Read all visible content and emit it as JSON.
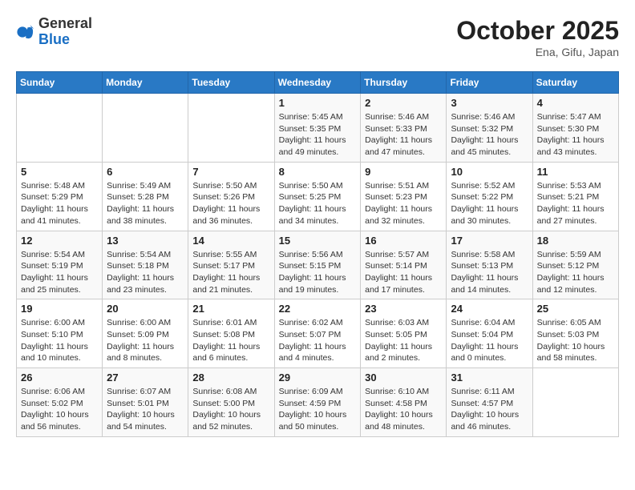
{
  "logo": {
    "general": "General",
    "blue": "Blue"
  },
  "header": {
    "month": "October 2025",
    "location": "Ena, Gifu, Japan"
  },
  "weekdays": [
    "Sunday",
    "Monday",
    "Tuesday",
    "Wednesday",
    "Thursday",
    "Friday",
    "Saturday"
  ],
  "weeks": [
    [
      {
        "day": "",
        "info": ""
      },
      {
        "day": "",
        "info": ""
      },
      {
        "day": "",
        "info": ""
      },
      {
        "day": "1",
        "sunrise": "5:45 AM",
        "sunset": "5:35 PM",
        "daylight": "11 hours and 49 minutes."
      },
      {
        "day": "2",
        "sunrise": "5:46 AM",
        "sunset": "5:33 PM",
        "daylight": "11 hours and 47 minutes."
      },
      {
        "day": "3",
        "sunrise": "5:46 AM",
        "sunset": "5:32 PM",
        "daylight": "11 hours and 45 minutes."
      },
      {
        "day": "4",
        "sunrise": "5:47 AM",
        "sunset": "5:30 PM",
        "daylight": "11 hours and 43 minutes."
      }
    ],
    [
      {
        "day": "5",
        "sunrise": "5:48 AM",
        "sunset": "5:29 PM",
        "daylight": "11 hours and 41 minutes."
      },
      {
        "day": "6",
        "sunrise": "5:49 AM",
        "sunset": "5:28 PM",
        "daylight": "11 hours and 38 minutes."
      },
      {
        "day": "7",
        "sunrise": "5:50 AM",
        "sunset": "5:26 PM",
        "daylight": "11 hours and 36 minutes."
      },
      {
        "day": "8",
        "sunrise": "5:50 AM",
        "sunset": "5:25 PM",
        "daylight": "11 hours and 34 minutes."
      },
      {
        "day": "9",
        "sunrise": "5:51 AM",
        "sunset": "5:23 PM",
        "daylight": "11 hours and 32 minutes."
      },
      {
        "day": "10",
        "sunrise": "5:52 AM",
        "sunset": "5:22 PM",
        "daylight": "11 hours and 30 minutes."
      },
      {
        "day": "11",
        "sunrise": "5:53 AM",
        "sunset": "5:21 PM",
        "daylight": "11 hours and 27 minutes."
      }
    ],
    [
      {
        "day": "12",
        "sunrise": "5:54 AM",
        "sunset": "5:19 PM",
        "daylight": "11 hours and 25 minutes."
      },
      {
        "day": "13",
        "sunrise": "5:54 AM",
        "sunset": "5:18 PM",
        "daylight": "11 hours and 23 minutes."
      },
      {
        "day": "14",
        "sunrise": "5:55 AM",
        "sunset": "5:17 PM",
        "daylight": "11 hours and 21 minutes."
      },
      {
        "day": "15",
        "sunrise": "5:56 AM",
        "sunset": "5:15 PM",
        "daylight": "11 hours and 19 minutes."
      },
      {
        "day": "16",
        "sunrise": "5:57 AM",
        "sunset": "5:14 PM",
        "daylight": "11 hours and 17 minutes."
      },
      {
        "day": "17",
        "sunrise": "5:58 AM",
        "sunset": "5:13 PM",
        "daylight": "11 hours and 14 minutes."
      },
      {
        "day": "18",
        "sunrise": "5:59 AM",
        "sunset": "5:12 PM",
        "daylight": "11 hours and 12 minutes."
      }
    ],
    [
      {
        "day": "19",
        "sunrise": "6:00 AM",
        "sunset": "5:10 PM",
        "daylight": "11 hours and 10 minutes."
      },
      {
        "day": "20",
        "sunrise": "6:00 AM",
        "sunset": "5:09 PM",
        "daylight": "11 hours and 8 minutes."
      },
      {
        "day": "21",
        "sunrise": "6:01 AM",
        "sunset": "5:08 PM",
        "daylight": "11 hours and 6 minutes."
      },
      {
        "day": "22",
        "sunrise": "6:02 AM",
        "sunset": "5:07 PM",
        "daylight": "11 hours and 4 minutes."
      },
      {
        "day": "23",
        "sunrise": "6:03 AM",
        "sunset": "5:05 PM",
        "daylight": "11 hours and 2 minutes."
      },
      {
        "day": "24",
        "sunrise": "6:04 AM",
        "sunset": "5:04 PM",
        "daylight": "11 hours and 0 minutes."
      },
      {
        "day": "25",
        "sunrise": "6:05 AM",
        "sunset": "5:03 PM",
        "daylight": "10 hours and 58 minutes."
      }
    ],
    [
      {
        "day": "26",
        "sunrise": "6:06 AM",
        "sunset": "5:02 PM",
        "daylight": "10 hours and 56 minutes."
      },
      {
        "day": "27",
        "sunrise": "6:07 AM",
        "sunset": "5:01 PM",
        "daylight": "10 hours and 54 minutes."
      },
      {
        "day": "28",
        "sunrise": "6:08 AM",
        "sunset": "5:00 PM",
        "daylight": "10 hours and 52 minutes."
      },
      {
        "day": "29",
        "sunrise": "6:09 AM",
        "sunset": "4:59 PM",
        "daylight": "10 hours and 50 minutes."
      },
      {
        "day": "30",
        "sunrise": "6:10 AM",
        "sunset": "4:58 PM",
        "daylight": "10 hours and 48 minutes."
      },
      {
        "day": "31",
        "sunrise": "6:11 AM",
        "sunset": "4:57 PM",
        "daylight": "10 hours and 46 minutes."
      },
      {
        "day": "",
        "info": ""
      }
    ]
  ]
}
